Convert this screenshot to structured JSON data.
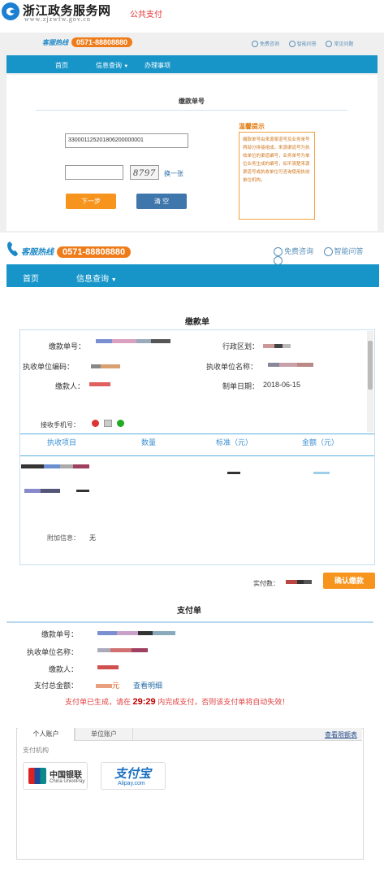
{
  "header": {
    "site_name": "浙江政务服务网",
    "site_url": "www.zjzwfw.gov.cn",
    "section": "公共支付"
  },
  "hotline": {
    "label": "客服热线",
    "number": "0571-88808880"
  },
  "toplinks": {
    "free": "免费咨询",
    "smart": "智能问答",
    "faq": "常见问题"
  },
  "nav": {
    "home": "首页",
    "info": "信息查询",
    "handle": "办理事项"
  },
  "query_form": {
    "title": "缴款单号",
    "bill_number_value": "330001125201806200000001",
    "captcha_text": "8797",
    "refresh_label": "换一张",
    "next_label": "下一步",
    "clear_label": "清 空",
    "tips_title": "温馨提示",
    "tips_text": "缴款单号由来源渠道号及业务单号两部分拼接组成，来源渠道号为执收单位的渠道编号，业务单号为单位业务生成的编号，如不清楚来源渠道号或执收单位可咨询使用执收单位机构。"
  },
  "bill": {
    "title": "缴款单",
    "labels": {
      "bill_no": "缴款单号：",
      "region": "行政区划：",
      "unit_code": "执收单位编码：",
      "unit_name": "执收单位名称：",
      "payer": "缴款人：",
      "date": "制单日期：",
      "phone": "接收手机号："
    },
    "date_value": "2018-06-15",
    "table_headers": [
      "执收项目",
      "数量",
      "标准（元）",
      "金额（元）"
    ],
    "extra_label": "附加信息：",
    "extra_value": "无",
    "paid_label": "实付数：",
    "confirm_label": "确认缴款"
  },
  "pay": {
    "title": "支付单",
    "labels": {
      "bill_no": "缴款单号：",
      "unit_name": "执收单位名称：",
      "payer": "缴款人：",
      "total": "支付总金额："
    },
    "amount_suffix": "元",
    "detail_link": "查看明细",
    "msg_prefix": "支付单已生成，请在",
    "countdown": "29:29",
    "msg_suffix": "内完成支付，否则该支付单将自动失效！",
    "tabs": [
      "个人账户",
      "单位账户"
    ],
    "quota_link": "查看限额表",
    "institution_label": "支付机构",
    "banks": [
      {
        "name_cn": "中国银联",
        "name_en": "China UnionPay"
      },
      {
        "name_cn": "支付宝",
        "name_en": "Alipay.com"
      }
    ]
  },
  "colors": {
    "nav": "#1795c9",
    "accent": "#f7941d",
    "link": "#2a6ea8",
    "alert": "#e04040"
  }
}
